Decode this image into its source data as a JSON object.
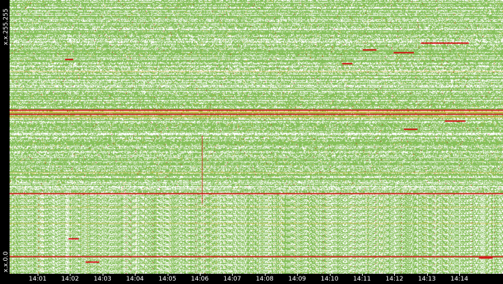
{
  "y_axis": {
    "top_label": "x.x.255.255",
    "bottom_label": "x.x.0.0"
  },
  "x_axis": {
    "labels": [
      "14:01",
      "14:02",
      "14:03",
      "14:04",
      "14:05",
      "14:06",
      "14:07",
      "14:08",
      "14:09",
      "14:10",
      "14:11",
      "14:12",
      "14:13",
      "14:14"
    ]
  },
  "colors": {
    "background": "#000000",
    "plot_background": "#ffffff",
    "low_activity": "#86c05a",
    "medium_activity": "#e0b030",
    "high_activity": "#d01010"
  },
  "chart_data": {
    "type": "heatmap",
    "title": "",
    "xlabel": "",
    "ylabel": "",
    "x": [
      "14:01",
      "14:02",
      "14:03",
      "14:04",
      "14:05",
      "14:06",
      "14:07",
      "14:08",
      "14:09",
      "14:10",
      "14:11",
      "14:12",
      "14:13",
      "14:14"
    ],
    "y_range": [
      "x.x.0.0",
      "x.x.255.255"
    ],
    "color_scale": [
      "white",
      "green",
      "orange",
      "red"
    ],
    "notable_features": [
      {
        "kind": "horizontal-band",
        "y_fraction_from_top": 0.41,
        "intensity": "high"
      },
      {
        "kind": "horizontal-band",
        "y_fraction_from_top": 0.71,
        "intensity": "high"
      },
      {
        "kind": "horizontal-band",
        "y_fraction_from_top": 0.94,
        "intensity": "high"
      },
      {
        "kind": "vertical-spike",
        "time": "14:06",
        "intensity": "high"
      }
    ]
  }
}
